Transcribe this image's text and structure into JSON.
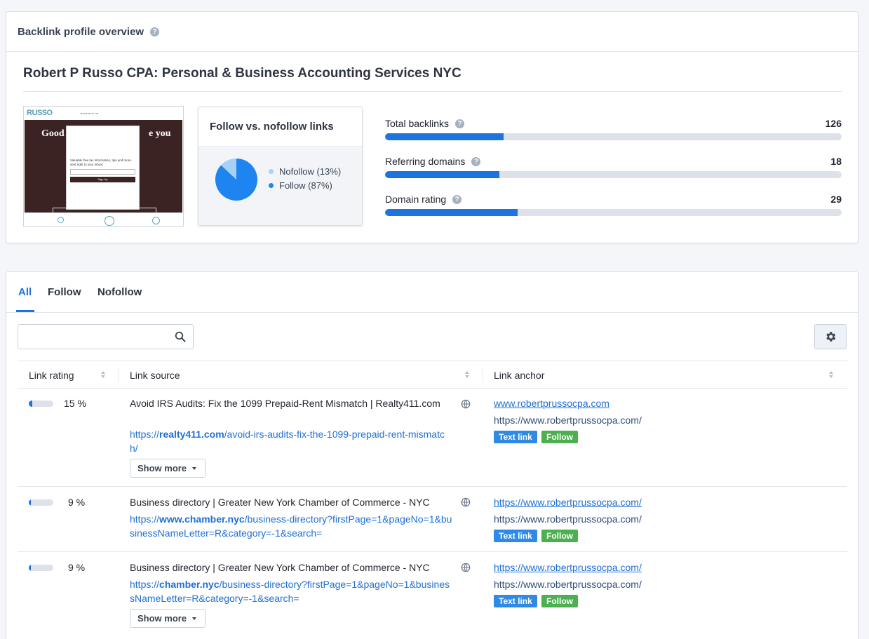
{
  "overview": {
    "title": "Backlink profile overview",
    "site_title": "Robert P Russo CPA: Personal & Business Accounting Services NYC",
    "thumbnail": {
      "logo": "RUSSO",
      "hero_left": "Good",
      "hero_right": "e you",
      "popup_text": "Valuable free tax information, tips and more - sent right to your inbox!",
      "popup_button": "Sign Up"
    },
    "follow_chart": {
      "title": "Follow vs. nofollow links",
      "nofollow_label": "Nofollow (13%)",
      "follow_label": "Follow (87%)"
    },
    "metrics": [
      {
        "name": "Total backlinks",
        "value": "126",
        "fill": 0.26
      },
      {
        "name": "Referring domains",
        "value": "18",
        "fill": 0.25
      },
      {
        "name": "Domain rating",
        "value": "29",
        "fill": 0.29
      }
    ]
  },
  "chart_data": {
    "type": "pie",
    "title": "Follow vs. nofollow links",
    "labels": [
      "Nofollow",
      "Follow"
    ],
    "values": [
      13,
      87
    ],
    "colors": [
      "#a8d1f7",
      "#1d84f0"
    ],
    "legend": "right"
  },
  "tabs": [
    {
      "label": "All",
      "active": true
    },
    {
      "label": "Follow",
      "active": false
    },
    {
      "label": "Nofollow",
      "active": false
    }
  ],
  "search": {
    "placeholder": ""
  },
  "table": {
    "columns": [
      "Link rating",
      "Link source",
      "Link anchor"
    ],
    "show_more_label": "Show more",
    "rows": [
      {
        "rating": "15 %",
        "rating_fraction": 0.15,
        "source_title": "Avoid IRS Audits: Fix the 1099 Prepaid-Rent Mismatch | Realty411.com",
        "url_prefix": "https://",
        "url_domain": "realty411.com",
        "url_path": "/avoid-irs-audits-fix-the-1099-prepaid-rent-mismatch/",
        "anchor": "www.robertprussocpa.com",
        "target": "https://www.robertprussocpa.com/",
        "badge_type": "Text link",
        "badge_follow": "Follow"
      },
      {
        "rating": "9 %",
        "rating_fraction": 0.09,
        "source_title": "Business directory | Greater New York Chamber of Commerce - NYC",
        "url_prefix": "https://",
        "url_domain": "www.chamber.nyc",
        "url_path": "/business-directory?firstPage=1&pageNo=1&businessNameLetter=R&category=-1&search=",
        "anchor": "https://www.robertprussocpa.com/",
        "target": "https://www.robertprussocpa.com/",
        "badge_type": "Text link",
        "badge_follow": "Follow"
      },
      {
        "rating": "9 %",
        "rating_fraction": 0.09,
        "source_title": "Business directory | Greater New York Chamber of Commerce - NYC",
        "url_prefix": "https://",
        "url_domain": "chamber.nyc",
        "url_path": "/business-directory?firstPage=1&pageNo=1&businessNameLetter=R&category=-1&search=",
        "anchor": "https://www.robertprussocpa.com/",
        "target": "https://www.robertprussocpa.com/",
        "badge_type": "Text link",
        "badge_follow": "Follow"
      }
    ]
  }
}
